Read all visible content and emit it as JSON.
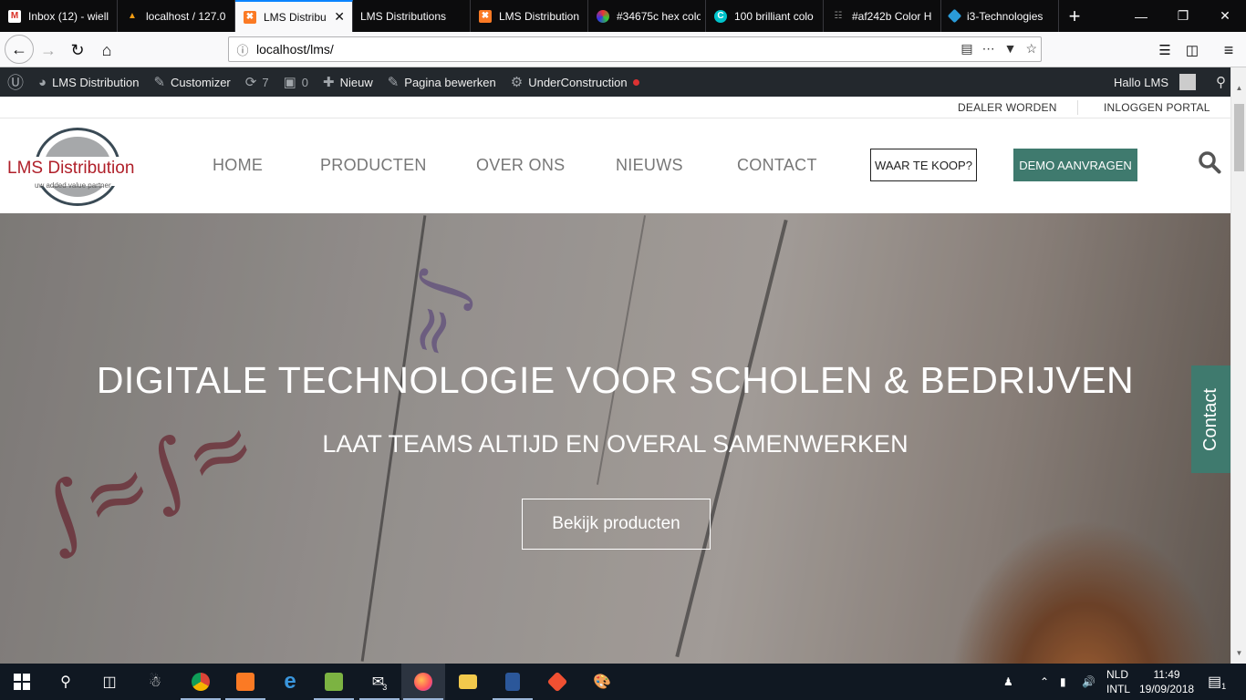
{
  "browser": {
    "tabs": [
      {
        "title": "Inbox (12) - wiell",
        "icon": "gmail-icon",
        "color": "#d93025"
      },
      {
        "title": "localhost / 127.0",
        "icon": "phpmyadmin-icon",
        "color": "#f39c12"
      },
      {
        "title": "LMS Distribu",
        "icon": "xampp-icon",
        "color": "#fb7a24",
        "active": true
      },
      {
        "title": "LMS Distributions",
        "icon": "",
        "color": ""
      },
      {
        "title": "LMS Distribution",
        "icon": "xampp-icon",
        "color": "#fb7a24"
      },
      {
        "title": "#34675c hex colo",
        "icon": "color-hex-icon",
        "color": "#7a5fd8"
      },
      {
        "title": "100 brilliant colo",
        "icon": "canva-icon",
        "color": "#00c4cc"
      },
      {
        "title": "#af242b Color H",
        "icon": "colorhexa-icon",
        "color": "#555555"
      },
      {
        "title": "i3-Technologies",
        "icon": "i3-icon",
        "color": "#2a9bd8"
      }
    ],
    "url": "localhost/lms/"
  },
  "wp_admin": {
    "site": "LMS Distribution",
    "customizer": "Customizer",
    "updates": "7",
    "comments": "0",
    "new": "Nieuw",
    "edit": "Pagina bewerken",
    "under_construction": "UnderConstruction",
    "greeting": "Hallo LMS"
  },
  "site": {
    "topbar": {
      "dealer": "DEALER WORDEN",
      "login": "INLOGGEN PORTAL"
    },
    "logo": {
      "name": "LMS Distribution",
      "tagline": "uw added value partner"
    },
    "nav": [
      "HOME",
      "PRODUCTEN",
      "OVER ONS",
      "NIEUWS",
      "CONTACT"
    ],
    "buy_button": "WAAR TE KOOP?",
    "demo_button": "DEMO AANVRAGEN",
    "hero": {
      "title": "DIGITALE TECHNOLOGIE VOOR SCHOLEN & BEDRIJVEN",
      "subtitle": "LAAT TEAMS ALTIJD EN OVERAL SAMENWERKEN",
      "button": "Bekijk producten"
    },
    "contact_tab": "Contact",
    "colors": {
      "accent": "#3f7a6e",
      "logo_red": "#b0202a"
    }
  },
  "taskbar": {
    "language": "NLD",
    "layout": "INTL",
    "time": "11:49",
    "date": "19/09/2018",
    "mail_badge": "3",
    "notification_badge": "1"
  }
}
